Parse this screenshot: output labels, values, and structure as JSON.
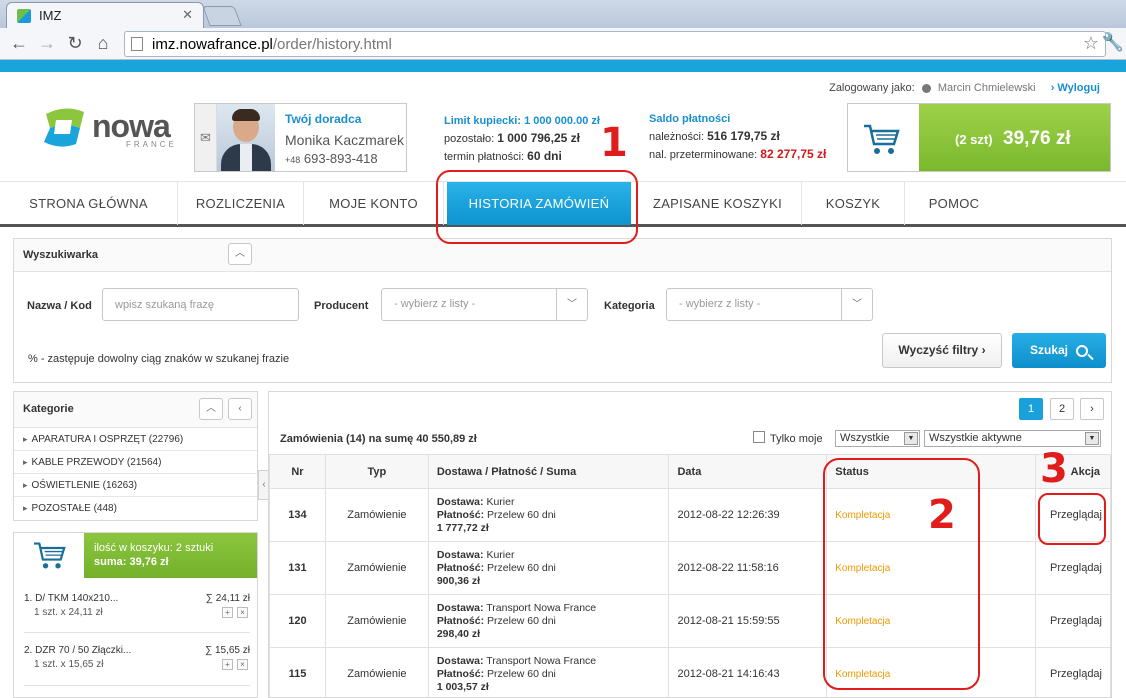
{
  "browser": {
    "tab_title": "IMZ",
    "url_host": "imz.nowafrance.pl",
    "url_path": "/order/history.html"
  },
  "header": {
    "logged_label": "Zalogowany jako:",
    "username": "Marcin Chmielewski",
    "logout": "Wyloguj",
    "logo_word": "nowa",
    "logo_sub": "FRANCE",
    "advisor_title": "Twój doradca",
    "advisor_name": "Monika Kaczmarek",
    "advisor_phone_prefix": "+48",
    "advisor_phone": "693-893-418",
    "limit_title": "Limit kupiecki:",
    "limit_value": "1 000 000.00 zł",
    "remaining_label": "pozostało:",
    "remaining_value": "1 000 796,25 zł",
    "term_label": "termin płatności:",
    "term_value": "60 dni",
    "saldo_title": "Saldo płatności",
    "receivables_label": "należności:",
    "receivables_value": "516 179,75 zł",
    "overdue_label": "nal. przeterminowane:",
    "overdue_value": "82 277,75 zł",
    "cart_count": "(2 szt)",
    "cart_total": "39,76 zł"
  },
  "nav": {
    "items": [
      {
        "label": "STRONA GŁÓWNA"
      },
      {
        "label": "ROZLICZENIA"
      },
      {
        "label": "MOJE KONTO"
      },
      {
        "label": "HISTORIA ZAMÓWIEŃ"
      },
      {
        "label": "ZAPISANE KOSZYKI"
      },
      {
        "label": "KOSZYK"
      },
      {
        "label": "POMOC"
      }
    ]
  },
  "search": {
    "title": "Wyszukiwarka",
    "name_label": "Nazwa / Kod",
    "name_placeholder": "wpisz szukaną frazę",
    "producer_label": "Producent",
    "producer_value": "- wybierz z listy -",
    "category_label": "Kategoria",
    "category_value": "- wybierz z listy -",
    "hint": "% - zastępuje dowolny ciąg znaków w szukanej frazie",
    "clear_button": "Wyczyść filtry",
    "search_button": "Szukaj"
  },
  "categories": {
    "title": "Kategorie",
    "items": [
      {
        "label": "APARATURA I OSPRZĘT (22796)"
      },
      {
        "label": "KABLE PRZEWODY (21564)"
      },
      {
        "label": "OŚWIETLENIE (16263)"
      },
      {
        "label": "POZOSTAŁE (448)"
      }
    ]
  },
  "minicart": {
    "line1": "ilość w koszyku: 2 sztuki",
    "line2": "suma: 39,76 zł",
    "items": [
      {
        "name": "1. D/ TKM 140x210...",
        "sum": "∑ 24,11 zł",
        "sub": "1 szt. x 24,11 zł"
      },
      {
        "name": "2. DZR 70 / 50 Złączki...",
        "sum": "∑ 15,65 zł",
        "sub": "1 szt. x 15,65 zł"
      }
    ]
  },
  "orders": {
    "pages": [
      "1",
      "2"
    ],
    "active_page": "1",
    "summary": "Zamówienia (14) na sumę 40 550,89 zł",
    "only_mine_label": "Tylko moje",
    "filter_type": "Wszystkie",
    "filter_status": "Wszystkie aktywne",
    "columns": [
      "Nr",
      "Typ",
      "Dostawa / Płatność / Suma",
      "Data",
      "Status",
      "Akcja"
    ],
    "delivery_label": "Dostawa:",
    "payment_label": "Płatność:",
    "rows": [
      {
        "nr": "134",
        "typ": "Zamówienie",
        "delivery": "Kurier",
        "payment": "Przelew 60 dni",
        "sum": "1 777,72 zł",
        "date": "2012-08-22 12:26:39",
        "status": "Kompletacja",
        "action": "Przeglądaj"
      },
      {
        "nr": "131",
        "typ": "Zamówienie",
        "delivery": "Kurier",
        "payment": "Przelew 60 dni",
        "sum": "900,36 zł",
        "date": "2012-08-22 11:58:16",
        "status": "Kompletacja",
        "action": "Przeglądaj"
      },
      {
        "nr": "120",
        "typ": "Zamówienie",
        "delivery": "Transport Nowa France",
        "payment": "Przelew 60 dni",
        "sum": "298,40 zł",
        "date": "2012-08-21 15:59:55",
        "status": "Kompletacja",
        "action": "Przeglądaj"
      },
      {
        "nr": "115",
        "typ": "Zamówienie",
        "delivery": "Transport Nowa France",
        "payment": "Przelew 60 dni",
        "sum": "1 003,57 zł",
        "date": "2012-08-21 14:16:43",
        "status": "Kompletacja",
        "action": "Przeglądaj"
      }
    ]
  },
  "annotations": {
    "n1": "1",
    "n2": "2",
    "n3": "3"
  },
  "colors": {
    "accent": "#1aa4dc",
    "brand_green": "#8cc63f",
    "status_orange": "#f29a00",
    "annotation_red": "#e01c1c"
  }
}
